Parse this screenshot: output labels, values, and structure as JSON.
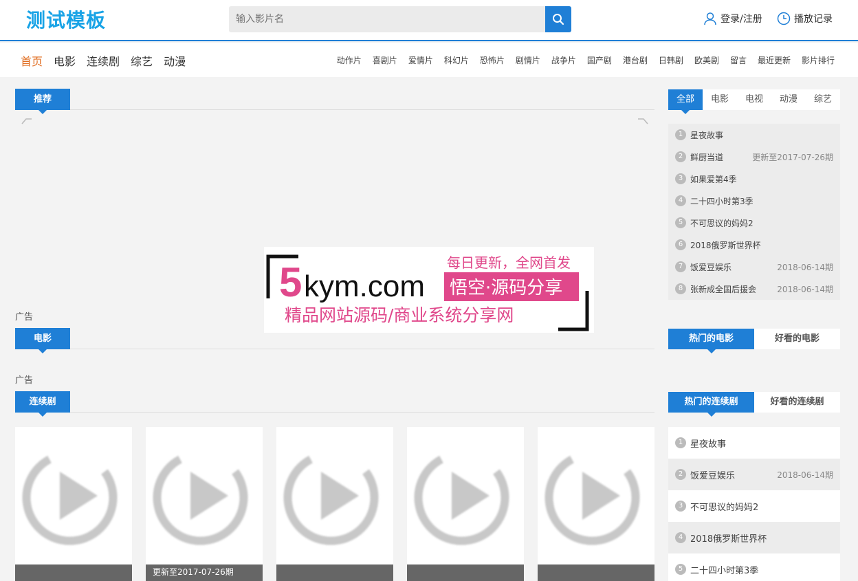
{
  "header": {
    "logo": "测试模板",
    "search_placeholder": "输入影片名",
    "login_label": "登录/注册",
    "history_label": "播放记录",
    "accent_color": "#1f7fd6"
  },
  "nav": {
    "main": [
      "首页",
      "电影",
      "连续剧",
      "综艺",
      "动漫"
    ],
    "active_index": 0,
    "sub": [
      "动作片",
      "喜剧片",
      "爱情片",
      "科幻片",
      "恐怖片",
      "剧情片",
      "战争片",
      "国产剧",
      "港台剧",
      "日韩剧",
      "欧美剧",
      "留言",
      "最近更新",
      "影片排行"
    ]
  },
  "sections": {
    "recommend": "推荐",
    "movie": "电影",
    "series": "连续剧",
    "ad1": "广告",
    "ad2": "广告"
  },
  "banner": {
    "brand_big": "5",
    "brand_rest": "kym.com",
    "slogan": "每日更新，全网首发",
    "badge": "悟空·源码分享",
    "subtitle": "精品网站源码/商业系统分享网"
  },
  "rank_tabs": [
    "全部",
    "电影",
    "电视",
    "动漫",
    "综艺"
  ],
  "rank_list": [
    {
      "n": "1",
      "title": "星夜故事",
      "date": ""
    },
    {
      "n": "2",
      "title": "鲜厨当道",
      "date": "更新至2017-07-26期"
    },
    {
      "n": "3",
      "title": "如果爱第4季",
      "date": ""
    },
    {
      "n": "4",
      "title": "二十四小时第3季",
      "date": ""
    },
    {
      "n": "5",
      "title": "不可思议的妈妈2",
      "date": ""
    },
    {
      "n": "6",
      "title": "2018俄罗斯世界杯",
      "date": ""
    },
    {
      "n": "7",
      "title": "饭爱豆娱乐",
      "date": "2018-06-14期"
    },
    {
      "n": "8",
      "title": "张新成全国后援会",
      "date": "2018-06-14期"
    }
  ],
  "movie_tabs": [
    "热门的电影",
    "好看的电影"
  ],
  "series_tabs": [
    "热门的连续剧",
    "好看的连续剧"
  ],
  "series_rank": [
    {
      "n": "1",
      "title": "星夜故事",
      "date": ""
    },
    {
      "n": "2",
      "title": "饭爱豆娱乐",
      "date": "2018-06-14期"
    },
    {
      "n": "3",
      "title": "不可思议的妈妈2",
      "date": ""
    },
    {
      "n": "4",
      "title": "2018俄罗斯世界杯",
      "date": ""
    },
    {
      "n": "5",
      "title": "二十四小时第3季",
      "date": ""
    }
  ],
  "series_cards": [
    {
      "caption": ""
    },
    {
      "caption": "更新至2017-07-26期"
    },
    {
      "caption": ""
    },
    {
      "caption": ""
    },
    {
      "caption": ""
    }
  ]
}
